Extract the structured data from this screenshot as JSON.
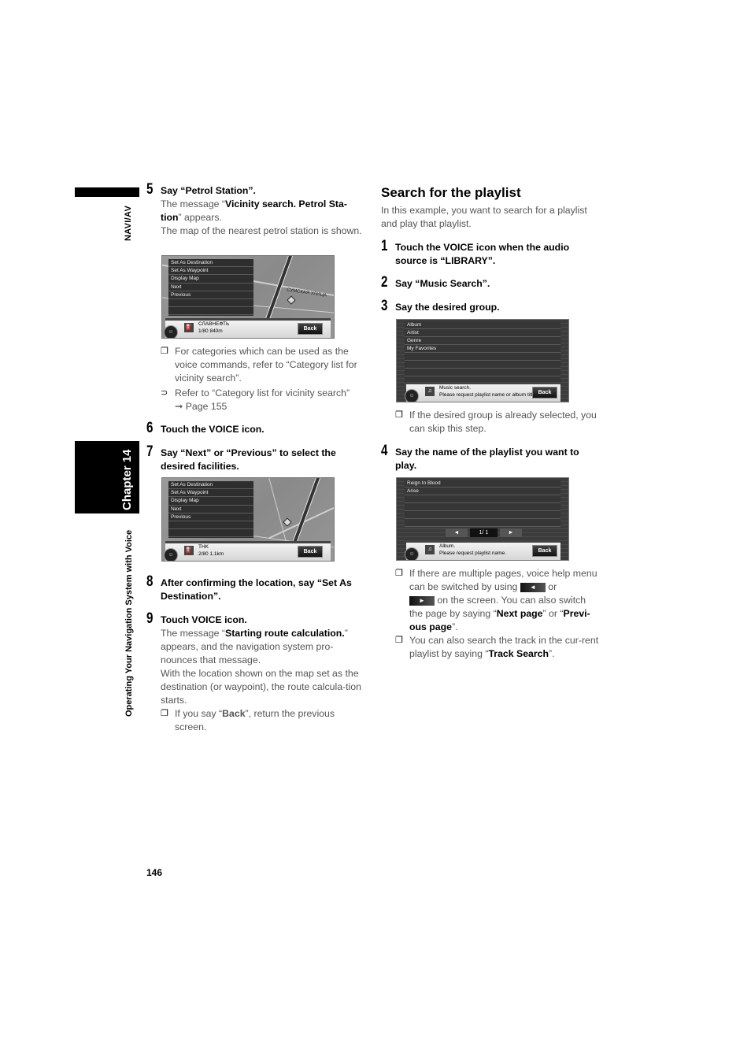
{
  "side": {
    "section_tab": "NAVI/AV",
    "chapter_tab": "Chapter 14",
    "chapter_title": "Operating Your Navigation System with Voice"
  },
  "left_column": {
    "step5": {
      "number": "5",
      "title": "Say “Petrol Station”.",
      "body_pre": "The message “",
      "body_bold": "Vicinity search. Petrol Sta-tion",
      "body_post": "” appears.",
      "body2": "The map of the nearest petrol station is shown.",
      "screen": {
        "menu": [
          "Set As Destination",
          "Set As Waypoint",
          "Display Map",
          "Next",
          "Previous",
          "",
          "",
          ""
        ],
        "status_name": "СЛАВНЕФТЬ",
        "status_info": "1/80  840m",
        "back_label": "Back",
        "map_label": "СУМСКАЯ УЛИЦА"
      },
      "note": "For categories which can be used as the voice commands, refer to “Category list for vicinity search”.",
      "ref": "Refer to “Category list for vicinity search”",
      "ref_page": "➞ Page 155"
    },
    "step6": {
      "number": "6",
      "title_pre": "Touch the ",
      "title_bold": "VOICE",
      "title_post": " icon."
    },
    "step7": {
      "number": "7",
      "title": "Say “Next” or “Previous” to select the desired facilities.",
      "screen": {
        "menu": [
          "Set As Destination",
          "Set As Waypoint",
          "Display Map",
          "Next",
          "Previous",
          "",
          "",
          ""
        ],
        "status_name": "THK",
        "status_info": "2/80  1.1km",
        "back_label": "Back"
      }
    },
    "step8": {
      "number": "8",
      "title": "After confirming the location, say “Set As Destination”."
    },
    "step9": {
      "number": "9",
      "title": "Touch VOICE icon.",
      "body_pre": "The message “",
      "body_bold": "Starting route calculation.",
      "body_post": "” appears, and the navigation system pro-nounces that message.",
      "body2": "With the location shown on the map set as the destination (or waypoint), the route calcula-tion starts.",
      "note_pre": "If you say “",
      "note_bold": "Back",
      "note_post": "”, return the previous screen."
    }
  },
  "right_column": {
    "heading": "Search for the playlist",
    "intro": "In this example, you want to search for a playlist and play that playlist.",
    "step1": {
      "number": "1",
      "title": "Touch the VOICE icon when the audio source is “LIBRARY”."
    },
    "step2": {
      "number": "2",
      "title": "Say “Music Search”."
    },
    "step3": {
      "number": "3",
      "title": "Say the desired group.",
      "screen": {
        "list": [
          "Album",
          "Artist",
          "Genre",
          "My Favorites",
          "",
          "",
          "",
          ""
        ],
        "status_line1": "Music search.",
        "status_line2": "Please request playlist name or album title.",
        "back_label": "Back"
      },
      "note": "If the desired group is already selected, you can skip this step."
    },
    "step4": {
      "number": "4",
      "title": "Say the name of the playlist you want to play.",
      "screen": {
        "list": [
          "Reign In Blood",
          "Arise",
          "",
          "",
          "",
          ""
        ],
        "pager_prev": "◄",
        "pager_value": "1/  1",
        "pager_next": "►",
        "status_line1": "Album.",
        "status_line2": "Please request playlist name.",
        "back_label": "Back"
      },
      "note1_a": "If there are multiple pages, voice help menu can be switched by using",
      "note1_or": "or",
      "note1_b": "on the screen. You can also switch the page by saying “",
      "note1_bold1": "Next page",
      "note1_mid": "” or “",
      "note1_bold2": "Previ-ous page",
      "note1_end": "”.",
      "btn_prev": "◄",
      "btn_next": "►",
      "note2_pre": "You can also search the track in the cur-rent playlist by saying “",
      "note2_bold": "Track Search",
      "note2_post": "”."
    }
  },
  "footer": {
    "page_number": "146"
  }
}
